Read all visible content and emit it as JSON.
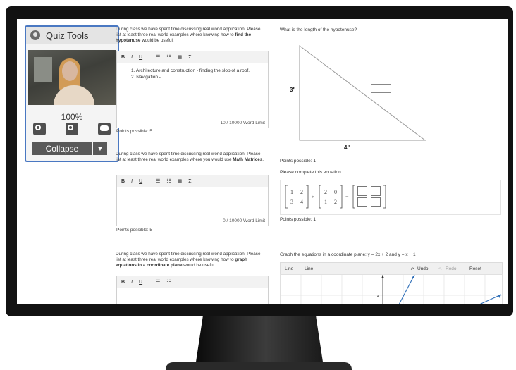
{
  "quiz_tools": {
    "title": "Quiz Tools",
    "zoom": "100%",
    "collapse_label": "Collapse",
    "icons": [
      "webcam-icon",
      "zoom-in-icon",
      "zoom-out-icon",
      "chat-icon",
      "chevron-down-icon"
    ]
  },
  "questions_left": [
    {
      "prompt_pre": "During class we have spent time discussing real world application. Please list at least three real world examples where knowing how to ",
      "prompt_bold": "find the hypotenuse",
      "prompt_post": " would be useful.",
      "items": [
        "Architecture and construction - finding the slop of a roof.",
        "Navigation -"
      ],
      "word_count": "10 / 10000 Word Limit",
      "points": "Points possible: 5"
    },
    {
      "prompt_pre": "During class we have spent time discussing real world application. Please list at least three real world examples where you would use ",
      "prompt_bold": "Math Matrices",
      "prompt_post": ".",
      "items": [],
      "word_count": "0 / 10000 Word Limit",
      "points": "Points possible: 5"
    },
    {
      "prompt_pre": "During class we have spent time discussing real world application. Please list at least three real world examples where knowing how to ",
      "prompt_bold": "graph equations in a coordinate plane",
      "prompt_post": " would be useful.",
      "items": []
    }
  ],
  "toolbar": {
    "bold": "B",
    "italic": "I",
    "underline": "U",
    "sigma": "Σ",
    "icons": [
      "bullet-list-icon",
      "numbered-list-icon",
      "table-icon"
    ]
  },
  "right": {
    "hyp_question": "What is the length of the hypotenuse?",
    "side_a": "3\"",
    "side_b": "4\"",
    "hyp_points": "Points possible: 1",
    "matrix_question": "Please complete this equation.",
    "matrix_a": [
      [
        "1",
        "2"
      ],
      [
        "3",
        "4"
      ]
    ],
    "matrix_b": [
      [
        "2",
        "0"
      ],
      [
        "1",
        "2"
      ]
    ],
    "times": "×",
    "equals": "=",
    "matrix_points": "Points possible: 1",
    "graph_question": "Graph the equations in a coordinate plane:  y = 2x + 2 and y = x − 1",
    "graph_tools": {
      "line1": "Line",
      "line2": "Line",
      "undo": "Undo",
      "redo": "Redo",
      "reset": "Reset"
    },
    "graph_tick": "4"
  },
  "colors": {
    "accent": "#4a78c2",
    "graph_line": "#2f6fb8"
  }
}
